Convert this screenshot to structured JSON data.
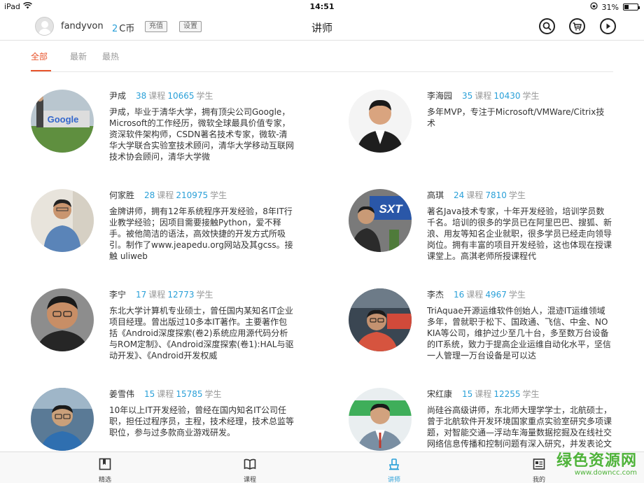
{
  "status_bar": {
    "device": "iPad",
    "time": "14:51",
    "battery": "31%",
    "battery_level": 0.31
  },
  "header": {
    "username": "fandyvon",
    "coin_count": "2",
    "coin_unit": "C币",
    "recharge_label": "充值",
    "settings_label": "设置",
    "title": "讲师"
  },
  "tabs": [
    {
      "label": "全部",
      "active": true
    },
    {
      "label": "最新",
      "active": false
    },
    {
      "label": "最热",
      "active": false
    }
  ],
  "labels": {
    "courses": "课程",
    "students": "学生"
  },
  "teachers": [
    {
      "name": "尹成",
      "courses": "38",
      "students": "10665",
      "bio": "尹成，毕业于清华大学，拥有顶尖公司Google，Microsoft的工作经历，微软全球最具价值专家，资深软件架构师，CSDN著名技术专家，微软-清华大学联合实验室技术顾问，清华大学移动互联网技术协会顾问，清华大学微"
    },
    {
      "name": "李海园",
      "courses": "35",
      "students": "10430",
      "bio": "多年MVP，专注于Microsoft/VMWare/Citrix技术"
    },
    {
      "name": "何家胜",
      "courses": "28",
      "students": "210975",
      "bio": "金牌讲师，拥有12年系统程序开发经验，8年IT行业教学经验；因项目需要接触Python，爱不释手。被他简洁的语法，高效快捷的开发方式所吸引。制作了www.jeapedu.org网站及其gcss。接触 uliweb"
    },
    {
      "name": "高琪",
      "courses": "24",
      "students": "7810",
      "bio": "著名Java技术专家，十年开发经验，培训学员数千名。培训的很多的学员已在阿里巴巴、搜狐、新浪、用友等知名企业就职，很多学员已经走向领导岗位。拥有丰富的项目开发经验，这也体现在授课课堂上。高淇老师所授课程代"
    },
    {
      "name": "李宁",
      "courses": "17",
      "students": "12773",
      "bio": "东北大学计算机专业硕士，曾任国内某知名IT企业项目经理。曾出版过10多本IT著作。主要著作包括《Android深度探索(卷2)系统应用源代码分析与ROM定制》、《Android深度探索(卷1):HAL与驱动开发》、《Android开发权威"
    },
    {
      "name": "李杰",
      "courses": "16",
      "students": "4967",
      "bio": "TriAquae开源运维软件创始人，混迹IT运维领域多年，曾就职于松下、国政通、飞信、中金、NOKIA等公司，维护过少至几十台，多至数万台设备的IT系统，致力于提高企业运维自动化水平，坚信一人管理一万台设备是可以达"
    },
    {
      "name": "姜雪伟",
      "courses": "15",
      "students": "15785",
      "bio": "10年以上IT开发经验，曾经在国内知名IT公司任职，担任过程序员，主程，技术经理，技术总监等职位，参与过多款商业游戏研发。"
    },
    {
      "name": "宋红康",
      "courses": "15",
      "students": "12255",
      "bio": "尚硅谷高级讲师，东北师大理学学士，北航硕士，曾于北航软件开发环境国家重点实验室研究多项课题，对智能交通—浮动车海量数据挖掘及在线社交网络信息传播和控制问题有深入研究，并发表论文数篇。先后参与过国"
    }
  ],
  "photo_text": {
    "google_sign": "Google",
    "sxt_logo": "SXT"
  },
  "tabbar": [
    {
      "label": "精选",
      "active": false
    },
    {
      "label": "课程",
      "active": false
    },
    {
      "label": "讲师",
      "active": true
    },
    {
      "label": "我的",
      "active": false
    }
  ],
  "watermark": {
    "main": "绿色资源网",
    "sub": "www.downcc.com"
  },
  "colors": {
    "accent_blue": "#2aa0d8",
    "tab_active": "#e8542c",
    "watermark_green": "#4fb33a"
  }
}
